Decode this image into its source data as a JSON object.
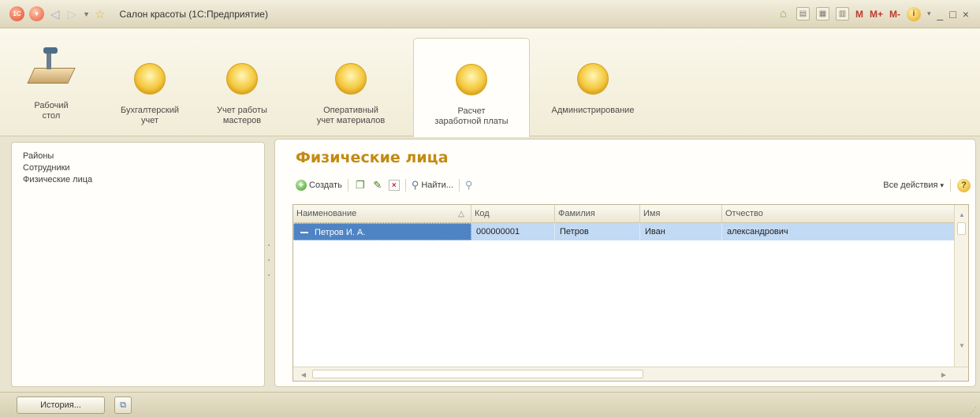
{
  "window": {
    "title": "Салон красоты (1С:Предприятие)",
    "logo_text": "1С"
  },
  "titlebar": {
    "m_label": "M",
    "mplus_label": "M+",
    "mminus_label": "M-",
    "minimize": "_",
    "restore": "□",
    "close": "×"
  },
  "sections": [
    {
      "label_line1": "Рабочий",
      "label_line2": "стол",
      "icon": "desk-icon"
    },
    {
      "label_line1": "Бухгалтерский",
      "label_line2": "учет",
      "icon": "section-icon"
    },
    {
      "label_line1": "Учет работы",
      "label_line2": "мастеров",
      "icon": "section-icon"
    },
    {
      "label_line1": "Оперативный",
      "label_line2": "учет материалов",
      "icon": "section-icon"
    },
    {
      "label_line1": "Расчет",
      "label_line2": "заработной платы",
      "icon": "section-icon",
      "active": true
    },
    {
      "label_line1": "Администрирование",
      "label_line2": "",
      "icon": "section-icon"
    }
  ],
  "navigation": {
    "items": [
      "Районы",
      "Сотрудники",
      "Физические лица"
    ]
  },
  "main": {
    "title": "Физические лица",
    "commands": {
      "create": "Создать",
      "find": "Найти...",
      "all_actions": "Все действия"
    },
    "table": {
      "columns": [
        "Наименование",
        "Код",
        "Фамилия",
        "Имя",
        "Отчество"
      ],
      "rows": [
        [
          "Петров И. А.",
          "000000001",
          "Петров",
          "Иван",
          "александрович"
        ]
      ]
    }
  },
  "bottom": {
    "history_button": "История..."
  }
}
